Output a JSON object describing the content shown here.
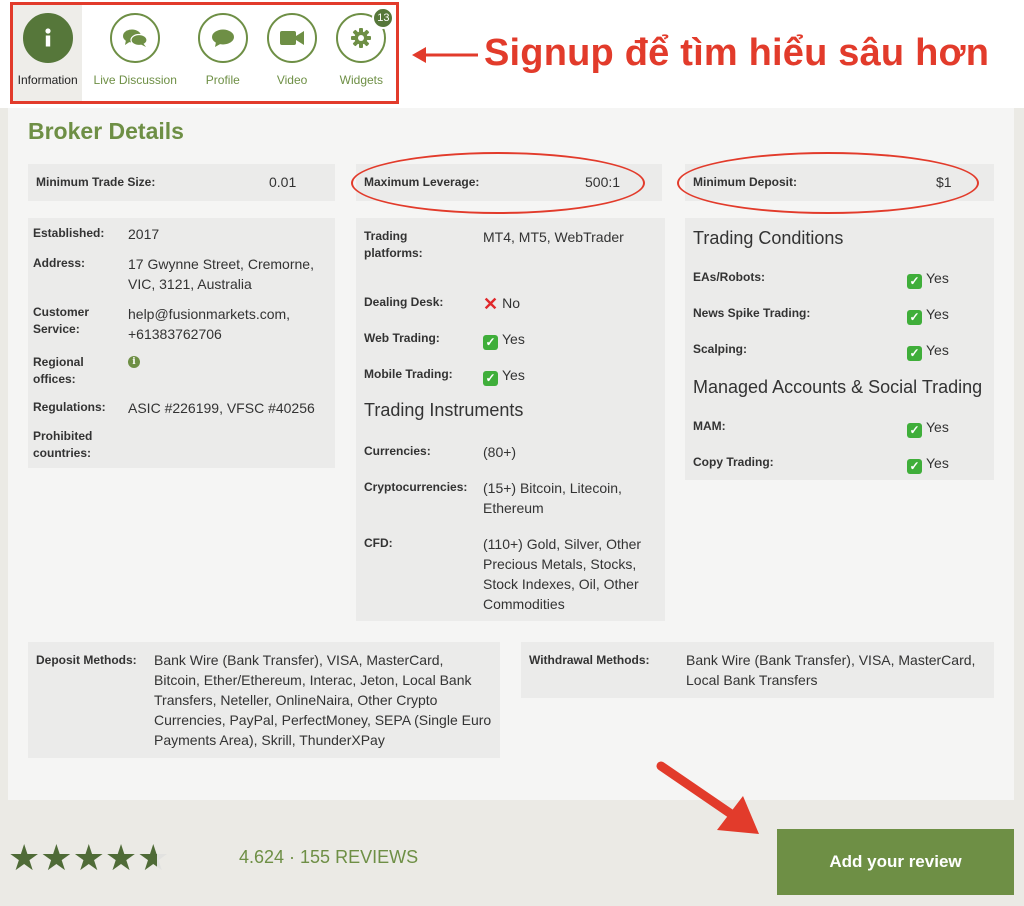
{
  "tabs": [
    {
      "label": "Information",
      "icon": "info-icon"
    },
    {
      "label": "Live Discussion",
      "icon": "chat-bubbles-icon"
    },
    {
      "label": "Profile",
      "icon": "speech-bubble-icon"
    },
    {
      "label": "Video",
      "icon": "video-camera-icon"
    },
    {
      "label": "Widgets",
      "icon": "gear-icon",
      "badge": "13"
    }
  ],
  "annotation": {
    "signup_text": "Signup để tìm hiểu sâu hơn"
  },
  "broker": {
    "title": "Broker Details",
    "min_trade_label": "Minimum Trade Size:",
    "min_trade_value": "0.01",
    "max_leverage_label": "Maximum Leverage:",
    "max_leverage_value": "500:1",
    "min_deposit_label": "Minimum Deposit:",
    "min_deposit_value": "$1",
    "established_label": "Established:",
    "established_value": "2017",
    "address_label": "Address:",
    "address_line1": "17 Gwynne Street, Cremorne,",
    "address_line2": "VIC, 3121, Australia",
    "customer_label1": "Customer",
    "customer_label2": "Service:",
    "customer_line1": "help@fusionmarkets.com,",
    "customer_line2": "+61383762706",
    "regional_label1": "Regional",
    "regional_label2": "offices:",
    "regional_icon": "i",
    "regulations_label": "Regulations:",
    "regulations_value": "ASIC #226199, VFSC #40256",
    "prohibited_label1": "Prohibited",
    "prohibited_label2": "countries:"
  },
  "platform": {
    "trading_label1": "Trading",
    "trading_label2": "platforms:",
    "trading_value": "MT4, MT5, WebTrader",
    "dealing_label": "Dealing Desk:",
    "dealing_value": "No",
    "web_label": "Web Trading:",
    "web_value": "Yes",
    "mobile_label": "Mobile Trading:",
    "mobile_value": "Yes",
    "instruments_heading": "Trading Instruments",
    "currencies_label": "Currencies:",
    "currencies_value": "(80+)",
    "crypto_label": "Cryptocurrencies:",
    "crypto_line1": "(15+) Bitcoin, Litecoin,",
    "crypto_line2": "Ethereum",
    "cfd_label": "CFD:",
    "cfd_line1": "(110+) Gold, Silver, Other",
    "cfd_line2": "Precious Metals, Stocks,",
    "cfd_line3": "Stock Indexes, Oil, Other",
    "cfd_line4": "Commodities"
  },
  "conditions": {
    "heading": "Trading Conditions",
    "eas_label": "EAs/Robots:",
    "eas_value": "Yes",
    "news_label": "News Spike Trading:",
    "news_value": "Yes",
    "scalping_label": "Scalping:",
    "scalping_value": "Yes",
    "managed_heading": "Managed Accounts & Social Trading",
    "mam_label": "MAM:",
    "mam_value": "Yes",
    "copy_label": "Copy Trading:",
    "copy_value": "Yes"
  },
  "methods": {
    "deposit_label": "Deposit Methods:",
    "deposit_line1": "Bank Wire (Bank Transfer), VISA, MasterCard,",
    "deposit_line2": "Bitcoin, Ether/Ethereum, Interac, Jeton, Local Bank",
    "deposit_line3": "Transfers, Neteller, OnlineNaira, Other Crypto",
    "deposit_line4": "Currencies, PayPal, PerfectMoney, SEPA (Single Euro",
    "deposit_line5": "Payments Area), Skrill, ThunderXPay",
    "withdrawal_label": "Withdrawal Methods:",
    "withdrawal_line1": "Bank Wire (Bank Transfer), VISA, MasterCard,",
    "withdrawal_line2": "Local Bank Transfers"
  },
  "footer": {
    "rating_fraction": 0.9248,
    "rating_text": "4.624 · 155 REVIEWS",
    "review_button": "Add your review"
  },
  "colors": {
    "accent": "#6e8f45",
    "annotation": "#e23b2b",
    "check": "#3fae3a"
  }
}
